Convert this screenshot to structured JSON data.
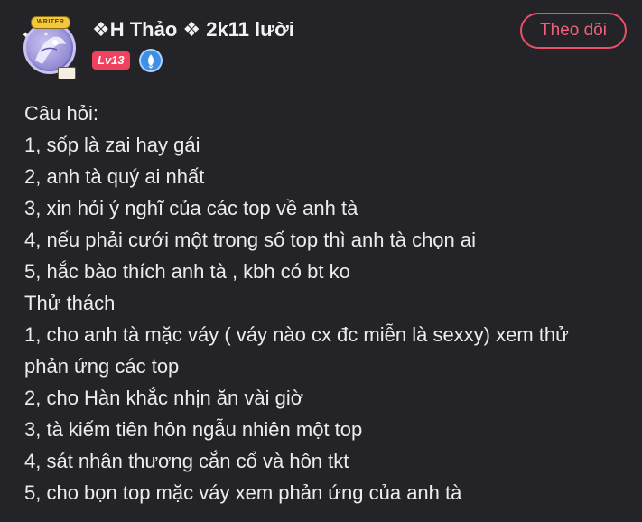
{
  "profile": {
    "username": "❖H Thảo ❖ 2k11 lười",
    "level": "Lv13",
    "avatar_badge": "WRITER",
    "follow_label": "Theo dõi",
    "icons": {
      "verified": "verified-badge-icon",
      "avatar": "avatar-image"
    },
    "colors": {
      "background": "#242428",
      "accent": "#f0425f",
      "follow_border": "#e8506a",
      "verified": "#3d8fe8"
    }
  },
  "post": {
    "lines": [
      "Câu hỏi:",
      "1, sốp là zai hay gái",
      "2, anh tà quý ai nhất",
      "3, xin hỏi ý nghĩ của các top về anh tà",
      "4, nếu phải cưới một trong số top thì anh tà chọn ai",
      "5, hắc bào thích anh tà , kbh có bt ko",
      "Thử thách",
      "1, cho anh tà mặc váy ( váy nào cx đc miễn là sexxy) xem thử",
      "phản ứng các top",
      "2, cho Hàn khắc nhịn ăn vài giờ",
      "3, tà kiếm tiên hôn ngẫu nhiên một top",
      "4, sát nhân thương cắn cổ và hôn tkt",
      "5, cho bọn top mặc váy xem phản ứng của anh tà"
    ]
  }
}
